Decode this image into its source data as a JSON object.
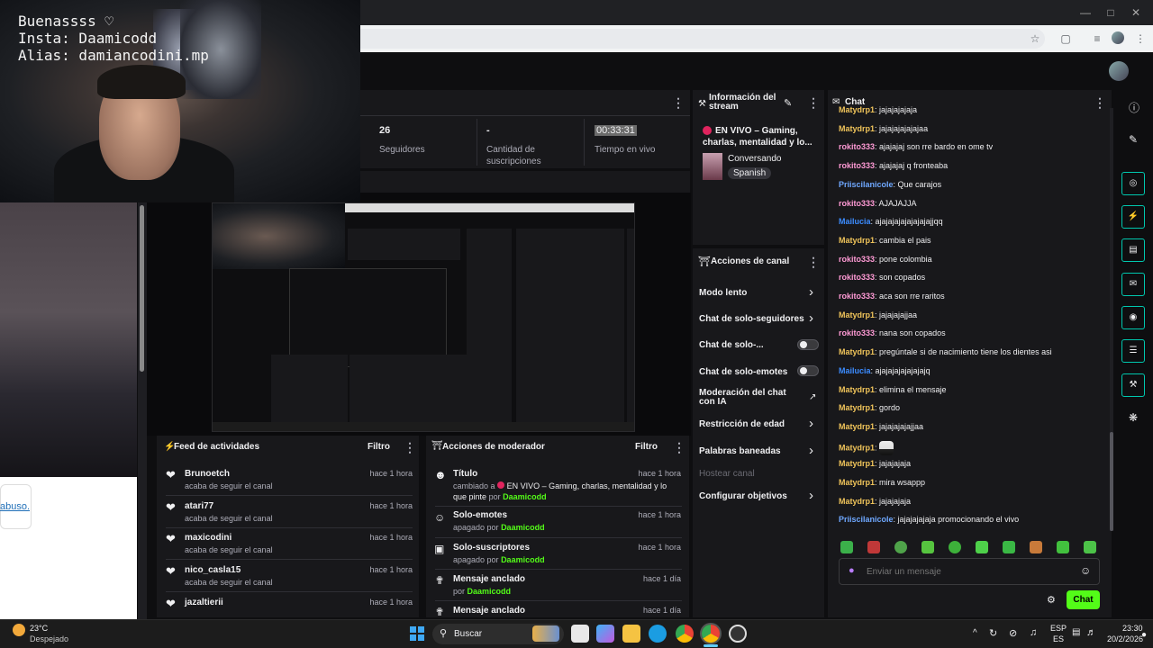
{
  "webcam": {
    "line1": "Buenassss ♡",
    "line2": "Insta: Daamicodd",
    "line3": "Alias: damiancodini.mp"
  },
  "left_link": "abuso.",
  "stats": [
    {
      "value": "26",
      "label": "Seguidores"
    },
    {
      "value": "-",
      "label": "Cantidad de suscripciones"
    },
    {
      "value": "00:33:31",
      "label": "Tiempo en vivo"
    }
  ],
  "stream_info": {
    "title": "Información del stream",
    "stream_title": "EN VIVO – Gaming, charlas, mentalidad y lo...",
    "category": "Conversando",
    "language": "Spanish"
  },
  "channel_actions": {
    "title": "Acciones de canal",
    "items": [
      {
        "label": "Modo lento",
        "control": "chevron"
      },
      {
        "label": "Chat de solo-seguidores",
        "control": "chevron"
      },
      {
        "label": "Chat de solo-...",
        "control": "toggle"
      },
      {
        "label": "Chat de solo-emotes",
        "control": "toggle"
      },
      {
        "label": "Moderación del chat con IA",
        "control": "external"
      },
      {
        "label": "Restricción de edad",
        "control": "chevron"
      },
      {
        "label": "Palabras baneadas",
        "control": "chevron"
      },
      {
        "label": "Hostear canal",
        "control": "none"
      },
      {
        "label": "Configurar objetivos",
        "control": "chevron"
      }
    ]
  },
  "activity_feed": {
    "title": "Feed de actividades",
    "filter": "Filtro",
    "items": [
      {
        "user": "Brunoetch",
        "action": "acaba de seguir el canal",
        "time": "hace 1 hora"
      },
      {
        "user": "atari77",
        "action": "acaba de seguir el canal",
        "time": "hace 1 hora"
      },
      {
        "user": "maxicodini",
        "action": "acaba de seguir el canal",
        "time": "hace 1 hora"
      },
      {
        "user": "nico_casla15",
        "action": "acaba de seguir el canal",
        "time": "hace 1 hora"
      },
      {
        "user": "jazaltierii",
        "action": "",
        "time": "hace 1 hora"
      }
    ]
  },
  "mod_actions": {
    "title": "Acciones de moderador",
    "filter": "Filtro",
    "items": [
      {
        "title": "Título",
        "detail": "cambiado a",
        "detail2": "EN VIVO – Gaming, charlas, mentalidad y lo que pinte",
        "by": "por",
        "who": "Daamicodd",
        "time": "hace 1 hora"
      },
      {
        "title": "Solo-emotes",
        "detail": "apagado por",
        "who": "Daamicodd",
        "time": "hace 1 hora"
      },
      {
        "title": "Solo-suscriptores",
        "detail": "apagado por",
        "who": "Daamicodd",
        "time": "hace 1 hora"
      },
      {
        "title": "Mensaje anclado",
        "detail": "por",
        "who": "Daamicodd",
        "time": "hace 1 día"
      },
      {
        "title": "Mensaje anclado",
        "detail": "",
        "who": "",
        "time": "hace 1 día"
      }
    ]
  },
  "chat": {
    "title": "Chat",
    "messages": [
      {
        "user": "Matydrp1",
        "color": "#f0c45a",
        "text": "jajajajajaja"
      },
      {
        "user": "Matydrp1",
        "color": "#f0c45a",
        "text": "jajajajajajajaa"
      },
      {
        "user": "rokito333",
        "color": "#ff9ad5",
        "text": "ajajajaj son rre bardo en ome tv"
      },
      {
        "user": "rokito333",
        "color": "#ff9ad5",
        "text": "ajajajaj q fronteaba"
      },
      {
        "user": "Priiscilanicole",
        "color": "#6fa8ff",
        "text": "Que carajos"
      },
      {
        "user": "rokito333",
        "color": "#ff9ad5",
        "text": "AJAJAJJA"
      },
      {
        "user": "Mailucia",
        "color": "#3c8cff",
        "text": "ajajajajajajajajajjqq"
      },
      {
        "user": "Matydrp1",
        "color": "#f0c45a",
        "text": "cambia el pais"
      },
      {
        "user": "rokito333",
        "color": "#ff9ad5",
        "text": "pone colombia"
      },
      {
        "user": "rokito333",
        "color": "#ff9ad5",
        "text": "son copados"
      },
      {
        "user": "rokito333",
        "color": "#ff9ad5",
        "text": "aca son rre raritos"
      },
      {
        "user": "Matydrp1",
        "color": "#f0c45a",
        "text": "jajajajajjaa"
      },
      {
        "user": "rokito333",
        "color": "#ff9ad5",
        "text": "nana son copados"
      },
      {
        "user": "Matydrp1",
        "color": "#f0c45a",
        "text": "pregúntale si de nacimiento tiene los dientes asi"
      },
      {
        "user": "Mailucia",
        "color": "#3c8cff",
        "text": "ajajajajajajajajq"
      },
      {
        "user": "Matydrp1",
        "color": "#f0c45a",
        "text": "elimina el mensaje"
      },
      {
        "user": "Matydrp1",
        "color": "#f0c45a",
        "text": "gordo"
      },
      {
        "user": "Matydrp1",
        "color": "#f0c45a",
        "text": "jajajajajajjaa"
      },
      {
        "user": "Matydrp1",
        "color": "#f0c45a",
        "text": ""
      },
      {
        "user": "Matydrp1",
        "color": "#f0c45a",
        "text": "jajajajaja"
      },
      {
        "user": "Matydrp1",
        "color": "#f0c45a",
        "text": "mira wsappp"
      },
      {
        "user": "Matydrp1",
        "color": "#f0c45a",
        "text": "jajajajaja"
      },
      {
        "user": "Priiscilanicole",
        "color": "#6fa8ff",
        "text": "jajajajajaja promocionando el vivo"
      }
    ],
    "placeholder": "Enviar un mensaje",
    "send_label": "Chat"
  },
  "taskbar": {
    "weather_temp": "23°C",
    "weather_desc": "Despejado",
    "search": "Buscar",
    "lang1": "ESP",
    "lang2": "ES",
    "time": "23:30",
    "date": "20/2/2026"
  },
  "colors": {
    "accent": "#53fc18",
    "panel": "#18181b",
    "bg": "#0e0e10",
    "rail": "#00c8af"
  }
}
